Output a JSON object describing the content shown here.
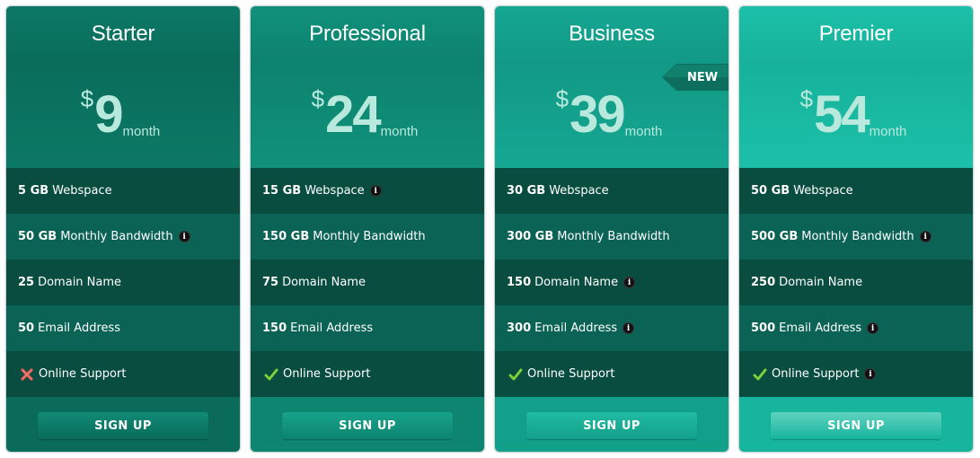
{
  "plans": [
    {
      "name": "Starter",
      "currency": "$",
      "price": "9",
      "period": "month",
      "features": [
        {
          "amount": "5 GB",
          "label": "Webspace",
          "info": false
        },
        {
          "amount": "50 GB",
          "label": "Monthly Bandwidth",
          "info": true
        },
        {
          "amount": "25",
          "label": "Domain Name",
          "info": false
        },
        {
          "amount": "50",
          "label": "Email Address",
          "info": false
        },
        {
          "amount": "",
          "label": "Online Support",
          "info": false,
          "support": "cross"
        }
      ],
      "button": "SIGN UP",
      "colors": {
        "head": "#0c7966",
        "price": "#0a6c5b",
        "dark": "#084d40",
        "light": "#0a6355",
        "foot": "#0a6b5a",
        "btn": "#108b76"
      }
    },
    {
      "name": "Professional",
      "currency": "$",
      "price": "24",
      "period": "month",
      "features": [
        {
          "amount": "15 GB",
          "label": "Webspace",
          "info": true
        },
        {
          "amount": "150 GB",
          "label": "Monthly Bandwidth",
          "info": false
        },
        {
          "amount": "75",
          "label": "Domain Name",
          "info": false
        },
        {
          "amount": "150",
          "label": "Email Address",
          "info": false
        },
        {
          "amount": "",
          "label": "Online Support",
          "info": false,
          "support": "check"
        }
      ],
      "button": "SIGN UP",
      "colors": {
        "head": "#10917b",
        "price": "#0d836f",
        "dark": "#084d40",
        "light": "#0a6355",
        "foot": "#0d8570",
        "btn": "#17a28a"
      }
    },
    {
      "name": "Business",
      "currency": "$",
      "price": "39",
      "period": "month",
      "badge": "NEW",
      "features": [
        {
          "amount": "30 GB",
          "label": "Webspace",
          "info": false
        },
        {
          "amount": "300 GB",
          "label": "Monthly Bandwidth",
          "info": false
        },
        {
          "amount": "150",
          "label": "Domain Name",
          "info": true
        },
        {
          "amount": "300",
          "label": "Email Address",
          "info": true
        },
        {
          "amount": "",
          "label": "Online Support",
          "info": false,
          "support": "check"
        }
      ],
      "button": "SIGN UP",
      "colors": {
        "head": "#15a893",
        "price": "#129985",
        "dark": "#084d40",
        "light": "#0a6355",
        "foot": "#13a08a",
        "btn": "#20bba3"
      }
    },
    {
      "name": "Premier",
      "currency": "$",
      "price": "54",
      "period": "month",
      "features": [
        {
          "amount": "50 GB",
          "label": "Webspace",
          "info": false
        },
        {
          "amount": "500 GB",
          "label": "Monthly Bandwidth",
          "info": true
        },
        {
          "amount": "250",
          "label": "Domain Name",
          "info": false
        },
        {
          "amount": "500",
          "label": "Email Address",
          "info": true
        },
        {
          "amount": "",
          "label": "Online Support",
          "info": true,
          "support": "check"
        }
      ],
      "button": "SIGN UP",
      "colors": {
        "head": "#1cc0a8",
        "price": "#17b19b",
        "dark": "#084d40",
        "light": "#0a6355",
        "foot": "#17b59d",
        "btn": "#5fd3c0"
      }
    }
  ]
}
